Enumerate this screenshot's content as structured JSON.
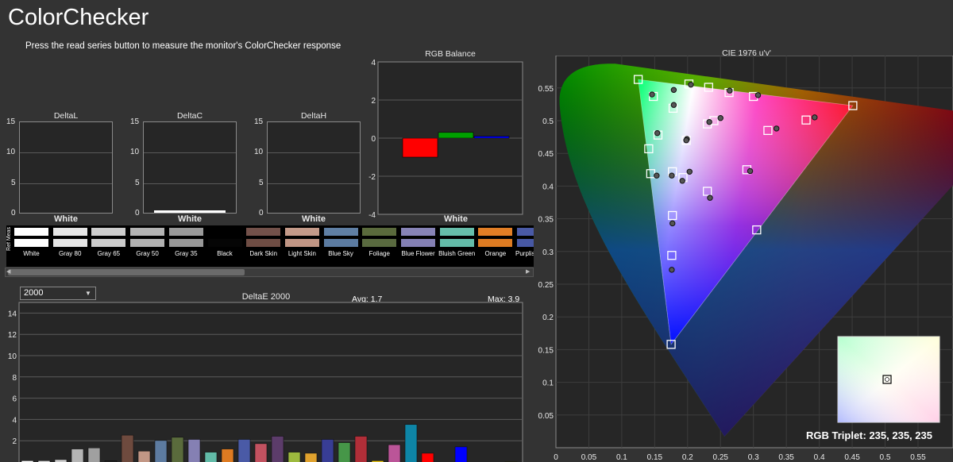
{
  "app": {
    "title": "ColorChecker",
    "instruction": "Press the read series button to measure the monitor's ColorChecker response"
  },
  "small_charts": [
    {
      "title": "DeltaL",
      "xlabel": "White",
      "yticks": [
        "15",
        "10",
        "5",
        "0"
      ],
      "value": 0
    },
    {
      "title": "DeltaC",
      "xlabel": "White",
      "yticks": [
        "15",
        "10",
        "5",
        "0"
      ],
      "value": 0.3
    },
    {
      "title": "DeltaH",
      "xlabel": "White",
      "yticks": [
        "15",
        "10",
        "5",
        "0"
      ],
      "value": 0
    }
  ],
  "chart_data": [
    {
      "type": "bar",
      "title": "RGB Balance",
      "xlabel": "White",
      "ylim": [
        -4,
        4
      ],
      "yticks": [
        "4",
        "2",
        "0",
        "-2",
        "-4"
      ],
      "categories": [
        "R",
        "G",
        "B"
      ],
      "values": [
        -1.0,
        0.3,
        0.1
      ],
      "colors": [
        "#ff0000",
        "#00a000",
        "#0000ff"
      ]
    },
    {
      "type": "bar",
      "title": "DeltaE 2000",
      "ylim": [
        0,
        15
      ],
      "yticks": [
        "14",
        "12",
        "10",
        "8",
        "6",
        "4",
        "2"
      ],
      "values": [
        0.5,
        0.5,
        0.6,
        1.6,
        1.7,
        0.5,
        2.9,
        1.4,
        2.4,
        2.7,
        2.5,
        1.3,
        1.6,
        2.5,
        2.1,
        2.8,
        1.3,
        1.2,
        2.5,
        2.2,
        2.8,
        0.5,
        2.0,
        3.9,
        1.2,
        0.0,
        1.8,
        0.3,
        0.3,
        0.4
      ],
      "colors": [
        "#ffffff",
        "#e0e0e0",
        "#cccccc",
        "#b5b5b5",
        "#a0a0a0",
        "#202020",
        "#6e4a3e",
        "#c29785",
        "#5d7ba0",
        "#5a6b3c",
        "#8580b3",
        "#62bba8",
        "#de7b22",
        "#4a5aa6",
        "#c25260",
        "#5c3c6a",
        "#9dba3e",
        "#e0a22e",
        "#383d95",
        "#469648",
        "#b02e38",
        "#e8c617",
        "#bb5598",
        "#0e85a6",
        "#ff0000",
        "#00ff00",
        "#0000ff",
        "#00ffff",
        "#ff00ff",
        "#ffff00"
      ]
    },
    {
      "type": "scatter",
      "title": "CIE 1976 u'v'",
      "xlim": [
        0,
        0.6
      ],
      "ylim": [
        0,
        0.6
      ],
      "xticks": [
        "0",
        "0.05",
        "0.1",
        "0.15",
        "0.2",
        "0.25",
        "0.3",
        "0.35",
        "0.4",
        "0.45",
        "0.5",
        "0.55"
      ],
      "yticks": [
        "0.55",
        "0.5",
        "0.45",
        "0.4",
        "0.35",
        "0.3",
        "0.25",
        "0.2",
        "0.15",
        "0.1",
        "0.05"
      ],
      "gamut": [
        [
          0.125,
          0.563
        ],
        [
          0.451,
          0.523
        ],
        [
          0.175,
          0.158
        ]
      ],
      "targets": [
        [
          0.125,
          0.563
        ],
        [
          0.451,
          0.523
        ],
        [
          0.175,
          0.158
        ],
        [
          0.202,
          0.556
        ],
        [
          0.232,
          0.551
        ],
        [
          0.263,
          0.543
        ],
        [
          0.3,
          0.537
        ],
        [
          0.38,
          0.501
        ],
        [
          0.322,
          0.485
        ],
        [
          0.29,
          0.425
        ],
        [
          0.23,
          0.392
        ],
        [
          0.305,
          0.333
        ],
        [
          0.177,
          0.355
        ],
        [
          0.176,
          0.294
        ],
        [
          0.141,
          0.457
        ],
        [
          0.144,
          0.419
        ],
        [
          0.177,
          0.422
        ],
        [
          0.193,
          0.413
        ],
        [
          0.198,
          0.47
        ],
        [
          0.24,
          0.5
        ],
        [
          0.23,
          0.495
        ],
        [
          0.178,
          0.519
        ],
        [
          0.155,
          0.478
        ],
        [
          0.148,
          0.537
        ]
      ],
      "measured": [
        [
          0.146,
          0.54
        ],
        [
          0.179,
          0.547
        ],
        [
          0.205,
          0.555
        ],
        [
          0.264,
          0.546
        ],
        [
          0.307,
          0.539
        ],
        [
          0.393,
          0.505
        ],
        [
          0.335,
          0.488
        ],
        [
          0.295,
          0.423
        ],
        [
          0.234,
          0.382
        ],
        [
          0.177,
          0.343
        ],
        [
          0.176,
          0.272
        ],
        [
          0.153,
          0.416
        ],
        [
          0.176,
          0.416
        ],
        [
          0.192,
          0.408
        ],
        [
          0.199,
          0.472
        ],
        [
          0.25,
          0.504
        ],
        [
          0.233,
          0.498
        ],
        [
          0.179,
          0.524
        ],
        [
          0.154,
          0.481
        ],
        [
          0.203,
          0.422
        ],
        [
          0.198,
          0.47
        ]
      ]
    }
  ],
  "patches": [
    {
      "name": "White",
      "ref": "#ffffff",
      "meas": "#ffffff"
    },
    {
      "name": "Gray 80",
      "ref": "#e6e6e6",
      "meas": "#e4e4e4"
    },
    {
      "name": "Gray 65",
      "ref": "#cdcdcd",
      "meas": "#cbcbcb"
    },
    {
      "name": "Gray 50",
      "ref": "#b3b3b3",
      "meas": "#b1b1b1"
    },
    {
      "name": "Gray 35",
      "ref": "#9a9a9a",
      "meas": "#989898"
    },
    {
      "name": "Black",
      "ref": "#000000",
      "meas": "#050505"
    },
    {
      "name": "Dark Skin",
      "ref": "#73514a",
      "meas": "#6f4d44"
    },
    {
      "name": "Light Skin",
      "ref": "#c49a89",
      "meas": "#c09584"
    },
    {
      "name": "Blue Sky",
      "ref": "#5f7fa4",
      "meas": "#5b7ba1"
    },
    {
      "name": "Foliage",
      "ref": "#5a6a3c",
      "meas": "#596a3f"
    },
    {
      "name": "Blue Flower",
      "ref": "#8783b6",
      "meas": "#837fb3"
    },
    {
      "name": "Bluish Green",
      "ref": "#66beaa",
      "meas": "#63bba8"
    },
    {
      "name": "Orange",
      "ref": "#e27e25",
      "meas": "#dd7b22"
    },
    {
      "name": "Purplish Blue",
      "ref": "#4a5aa6",
      "meas": "#4758a4"
    }
  ],
  "patch_strip": {
    "ref_meas_label": "Ref Meas"
  },
  "deltae_panel": {
    "selected": "2000",
    "avg": "Avg: 1.7",
    "max": "Max: 3.9"
  },
  "cie_panel": {
    "triplet": "RGB Triplet: 235, 235, 235"
  },
  "scroll": {
    "left_arrow": "◀",
    "right_arrow": "▶"
  }
}
